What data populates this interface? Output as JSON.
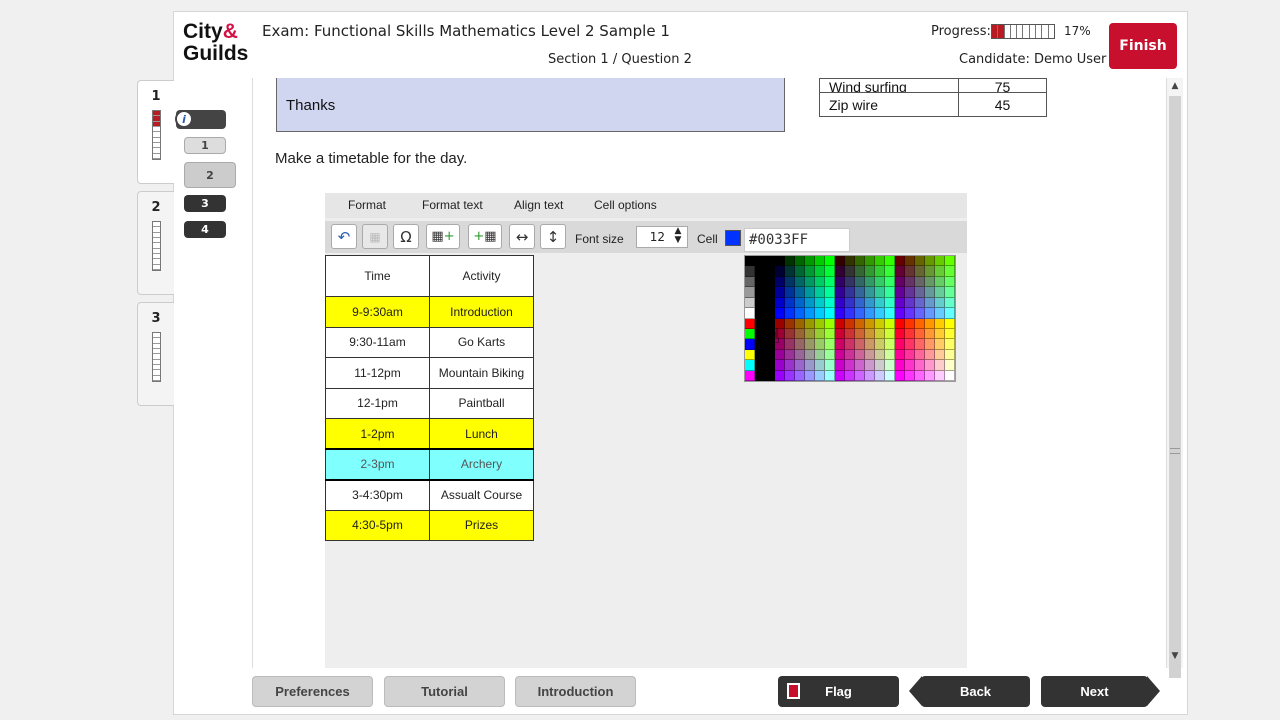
{
  "header": {
    "logo_line1": "City",
    "logo_amp": "&",
    "logo_line2": "Guilds",
    "exam_title": "Exam: Functional Skills Mathematics Level 2 Sample 1",
    "section_label": "Section 1 / Question 2",
    "progress_label": "Progress:",
    "progress_percent": "17%",
    "progress_fraction": 0.17,
    "candidate": "Candidate: Demo User",
    "finish_label": "Finish"
  },
  "sections": [
    {
      "number": "1",
      "progress_fraction": 0.33
    },
    {
      "number": "2",
      "progress_fraction": 0
    },
    {
      "number": "3",
      "progress_fraction": 0
    }
  ],
  "question_nav": {
    "info_icon": "i",
    "items": [
      "1",
      "2",
      "3",
      "4"
    ]
  },
  "question": {
    "thanks_text": "Thanks",
    "reference_table": [
      [
        "Wind surfing",
        "75"
      ],
      [
        "Zip wire",
        "45"
      ]
    ],
    "prompt": "Make a timetable for the day."
  },
  "editor": {
    "menu": [
      "Format",
      "Format text",
      "Align text",
      "Cell options"
    ],
    "toolbar_icons": [
      "undo-icon",
      "merge-cells-icon",
      "special-character-icon",
      "insert-row-icon",
      "insert-column-icon",
      "column-width-icon",
      "row-height-icon"
    ],
    "font_size_label": "Font size",
    "font_size_value": "12",
    "cell_label": "Cell",
    "cell_color": "#0033FF",
    "color_value": "#0033FF"
  },
  "timetable": {
    "headers": [
      "Time",
      "Activity"
    ],
    "rows": [
      {
        "time": "9-9:30am",
        "activity": "Introduction",
        "color": "#FFFF00"
      },
      {
        "time": "9:30-11am",
        "activity": "Go Karts",
        "color": "#FFFFFF"
      },
      {
        "time": "11-12pm",
        "activity": "Mountain Biking",
        "color": "#FFFFFF"
      },
      {
        "time": "12-1pm",
        "activity": "Paintball",
        "color": "#FFFFFF"
      },
      {
        "time": "1-2pm",
        "activity": "Lunch",
        "color": "#FFFF00"
      },
      {
        "time": "2-3pm",
        "activity": "Archery",
        "color": "#80FFFF"
      },
      {
        "time": "3-4:30pm",
        "activity": "Assualt Course",
        "color": "#FFFFFF"
      },
      {
        "time": "4:30-5pm",
        "activity": "Prizes",
        "color": "#FFFF00"
      }
    ]
  },
  "footer": {
    "preferences": "Preferences",
    "tutorial": "Tutorial",
    "introduction": "Introduction",
    "flag": "Flag",
    "back": "Back",
    "next": "Next"
  },
  "colors": {
    "brand_red": "#C8102E",
    "progress_red": "#B81C22",
    "thanks_bg": "#D0D6F0",
    "highlight_yellow": "#FFFF00",
    "highlight_cyan": "#80FFFF"
  }
}
